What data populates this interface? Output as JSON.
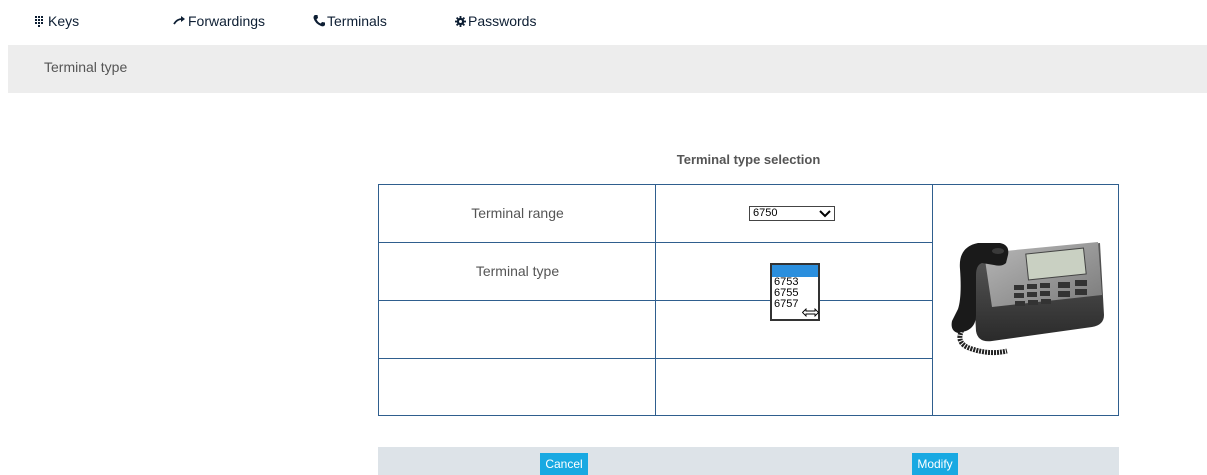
{
  "nav": {
    "keys": "Keys",
    "forwardings": "Forwardings",
    "terminals": "Terminals",
    "passwords": "Passwords"
  },
  "breadcrumb": "Terminal type",
  "section_title": "Terminal type selection",
  "form": {
    "terminal_range_label": "Terminal range",
    "terminal_range_value": "6750",
    "terminal_type_label": "Terminal type",
    "terminal_type_options": [
      "6753",
      "6755",
      "6757"
    ]
  },
  "buttons": {
    "cancel": "Cancel",
    "modify": "Modify"
  },
  "colors": {
    "nav_text": "#0d1e33",
    "table_border": "#2f5e8e",
    "button_bg": "#18a9e2",
    "listbox_highlight": "#2b8fde"
  }
}
